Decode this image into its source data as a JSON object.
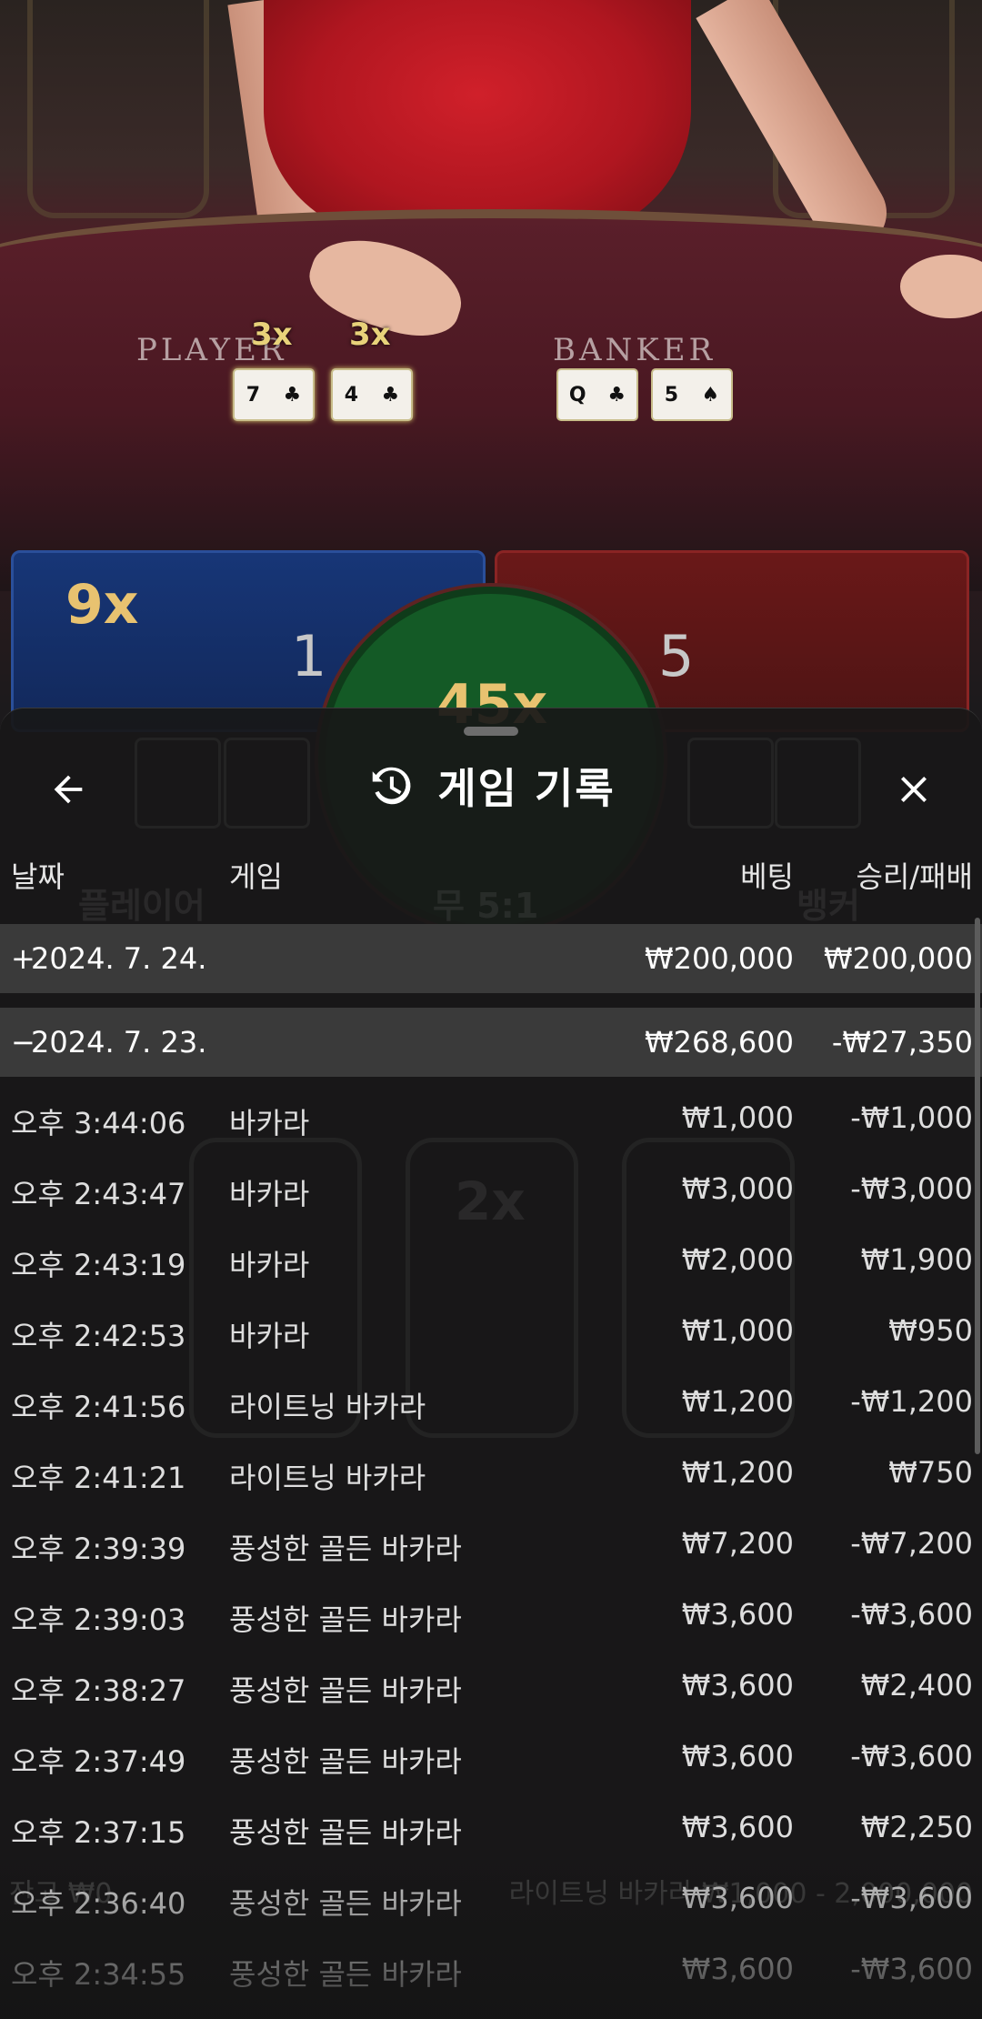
{
  "scene": {
    "player_label": "PLAYER",
    "banker_label": "BANKER",
    "player_card_multipliers": [
      "3x",
      "3x"
    ],
    "player_cards": [
      {
        "rank": "7",
        "suit": "♣"
      },
      {
        "rank": "4",
        "suit": "♣"
      }
    ],
    "banker_cards": [
      {
        "rank": "Q",
        "suit": "♣"
      },
      {
        "rank": "5",
        "suit": "♠"
      }
    ],
    "player_bet_multiplier": "9x",
    "player_total": "1",
    "banker_total": "5",
    "tie_multiplier": "45x"
  },
  "background_ghost": {
    "tie_label": "무 5:1",
    "player_label": "플레이어",
    "banker_label": "뱅커",
    "slot_multiplier": "2x",
    "footer_left": "잔고 ₩0",
    "footer_right": "라이트닝 바카라 ₩1,000 - 2,000,000"
  },
  "sheet": {
    "title": "게임 기록",
    "icons": {
      "back": "arrow-left-icon",
      "history": "history-clock-icon",
      "close": "close-icon"
    },
    "columns": {
      "date": "날짜",
      "game": "게임",
      "bet": "베팅",
      "win_loss": "승리/패배"
    },
    "groups": [
      {
        "toggle": "+",
        "date": "2024. 7. 24.",
        "bet": "₩200,000",
        "win_loss": "₩200,000"
      },
      {
        "toggle": "−",
        "date": "2024. 7. 23.",
        "bet": "₩268,600",
        "win_loss": "-₩27,350"
      }
    ],
    "rows": [
      {
        "time": "오후 3:44:06",
        "game": "바카라",
        "bet": "₩1,000",
        "win_loss": "-₩1,000"
      },
      {
        "time": "오후 2:43:47",
        "game": "바카라",
        "bet": "₩3,000",
        "win_loss": "-₩3,000"
      },
      {
        "time": "오후 2:43:19",
        "game": "바카라",
        "bet": "₩2,000",
        "win_loss": "₩1,900"
      },
      {
        "time": "오후 2:42:53",
        "game": "바카라",
        "bet": "₩1,000",
        "win_loss": "₩950"
      },
      {
        "time": "오후 2:41:56",
        "game": "라이트닝 바카라",
        "bet": "₩1,200",
        "win_loss": "-₩1,200"
      },
      {
        "time": "오후 2:41:21",
        "game": "라이트닝 바카라",
        "bet": "₩1,200",
        "win_loss": "₩750"
      },
      {
        "time": "오후 2:39:39",
        "game": "풍성한 골든 바카라",
        "bet": "₩7,200",
        "win_loss": "-₩7,200"
      },
      {
        "time": "오후 2:39:03",
        "game": "풍성한 골든 바카라",
        "bet": "₩3,600",
        "win_loss": "-₩3,600"
      },
      {
        "time": "오후 2:38:27",
        "game": "풍성한 골든 바카라",
        "bet": "₩3,600",
        "win_loss": "₩2,400"
      },
      {
        "time": "오후 2:37:49",
        "game": "풍성한 골든 바카라",
        "bet": "₩3,600",
        "win_loss": "-₩3,600"
      },
      {
        "time": "오후 2:37:15",
        "game": "풍성한 골든 바카라",
        "bet": "₩3,600",
        "win_loss": "₩2,250"
      },
      {
        "time": "오후 2:36:40",
        "game": "풍성한 골든 바카라",
        "bet": "₩3,600",
        "win_loss": "-₩3,600"
      },
      {
        "time": "오후 2:34:55",
        "game": "풍성한 골든 바카라",
        "bet": "₩3,600",
        "win_loss": "-₩3,600"
      }
    ]
  }
}
